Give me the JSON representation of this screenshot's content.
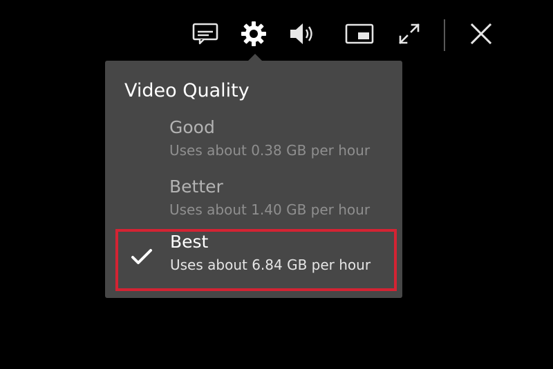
{
  "toolbar": {
    "icons": [
      {
        "name": "subtitles-icon"
      },
      {
        "name": "gear-icon"
      },
      {
        "name": "volume-icon"
      },
      {
        "name": "picture-in-picture-icon"
      },
      {
        "name": "fullscreen-icon"
      },
      {
        "name": "close-icon"
      }
    ],
    "icon_color": "#e6e6e6"
  },
  "quality_menu": {
    "title": "Video Quality",
    "selected_index": 2,
    "options": [
      {
        "label": "Good",
        "description": "Uses about 0.38 GB per hour",
        "selected": false
      },
      {
        "label": "Better",
        "description": "Uses about 1.40 GB per hour",
        "selected": false
      },
      {
        "label": "Best",
        "description": "Uses about 6.84 GB per hour",
        "selected": true
      }
    ],
    "highlight_color": "#d42333",
    "panel_color": "#474747"
  }
}
